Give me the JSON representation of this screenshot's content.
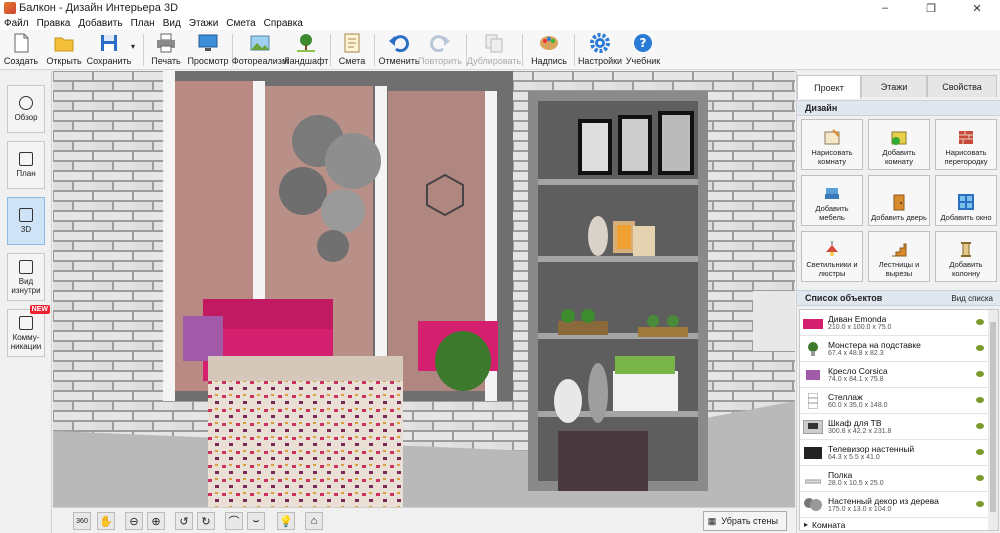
{
  "window": {
    "title": "Балкон - Дизайн Интерьера 3D",
    "minimize": "–",
    "maximize": "❐",
    "close": "✕"
  },
  "menu": [
    "Файл",
    "Правка",
    "Добавить",
    "План",
    "Вид",
    "Этажи",
    "Смета",
    "Справка"
  ],
  "toolbar": {
    "create": "Создать",
    "open": "Открыть",
    "save": "Сохранить",
    "print": "Печать",
    "preview": "Просмотр",
    "photorealism": "Фотореализм",
    "landscape": "Ландшафт",
    "estimate": "Смета",
    "undo": "Отменить",
    "redo": "Повторить",
    "duplicate": "Дублировать",
    "labels": "Надпись",
    "settings": "Настройки",
    "tutorial": "Учебник"
  },
  "left_views": [
    "Обзор",
    "План",
    "3D",
    "Вид изнутри",
    "Комму-никации"
  ],
  "new_badge": "NEW",
  "right": {
    "tabs": [
      "Проект",
      "Этажи",
      "Свойства"
    ],
    "design_header": "Дизайн",
    "design_buttons": [
      "Нарисовать комнату",
      "Добавить комнату",
      "Нарисовать перегородку",
      "Добавить мебель",
      "Добавить дверь",
      "Добавить окно",
      "Светильники и люстры",
      "Лестницы и вырезы",
      "Добавить колонну"
    ],
    "objects_header": "Список объектов",
    "view_list": "Вид списка",
    "objects": [
      {
        "name": "Диван Emonda",
        "dims": "210.0 x 100.0 x 75.0"
      },
      {
        "name": "Монстера на подставке",
        "dims": "67.4 x 48.8 x 82.3"
      },
      {
        "name": "Кресло Corsica",
        "dims": "74.0 x 84.1 x 75.8"
      },
      {
        "name": "Стеллаж",
        "dims": "60.0 x 35.0 x 148.0"
      },
      {
        "name": "Шкаф для ТВ",
        "dims": "300.8 x 42.2 x 231.8"
      },
      {
        "name": "Телевизор настенный",
        "dims": "64.3 x 5.5 x 41.0"
      },
      {
        "name": "Полка",
        "dims": "28.0 x 10.5 x 25.0"
      },
      {
        "name": "Настенный декор из дерева",
        "dims": "175.0 x 13.0 x 104.0"
      },
      {
        "name": "Комната",
        "dims": ""
      }
    ]
  },
  "bottom": {
    "remove_walls": "Убрать стены",
    "rot_label": "360"
  },
  "colors": {
    "accent": "#2a7bd8",
    "active_view": "#cfe3f7",
    "pink_sofa": "#d4206e",
    "shelf_grey": "#8a8a8a"
  }
}
